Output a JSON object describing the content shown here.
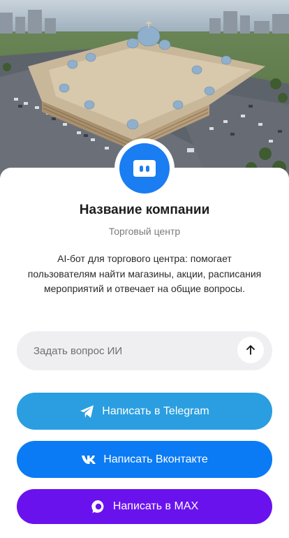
{
  "company": {
    "name": "Название компании",
    "type": "Торговый центр",
    "description": "AI-бот для торгового центра: помогает пользователям найти магазины, акции, расписания мероприятий и отвечает на общие вопросы."
  },
  "ask": {
    "placeholder": "Задать вопрос ИИ",
    "send_icon": "arrow-up-icon"
  },
  "buttons": [
    {
      "label": "Написать в Telegram",
      "icon": "telegram-icon",
      "color": "#2a9ee0"
    },
    {
      "label": "Написать Вконтакте",
      "icon": "vk-icon",
      "color": "#0b7bf5"
    },
    {
      "label": "Написать в MAX",
      "icon": "max-icon",
      "color": "#6a12ee"
    }
  ],
  "colors": {
    "avatar": "#1a7df2",
    "input_bg": "#efeff1"
  }
}
